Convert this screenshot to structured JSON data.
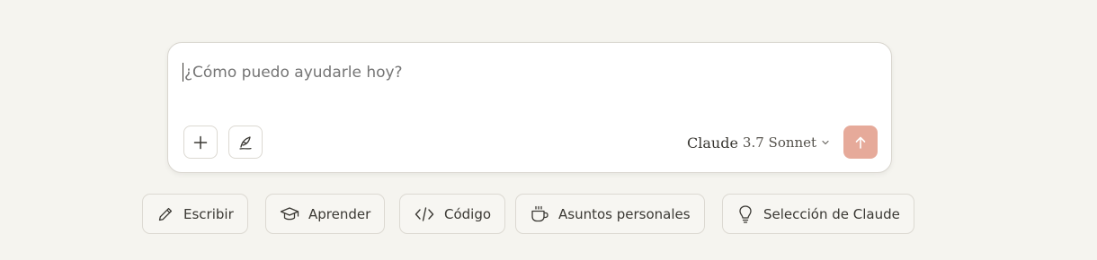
{
  "composer": {
    "placeholder": "¿Cómo puedo ayudarle hoy?",
    "value": ""
  },
  "toolbar": {
    "add_icon": "plus-icon",
    "style_icon": "quill-icon"
  },
  "model": {
    "name": "Claude",
    "version": "3.7 Sonnet"
  },
  "send": {
    "icon": "arrow-up-icon",
    "color": "#e6aa9a"
  },
  "suggestions": [
    {
      "label": "Escribir",
      "icon": "pencil-icon"
    },
    {
      "label": "Aprender",
      "icon": "graduation-cap-icon"
    },
    {
      "label": "Código",
      "icon": "code-icon"
    },
    {
      "label": "Asuntos personales",
      "icon": "coffee-cup-icon"
    },
    {
      "label": "Selección de Claude",
      "icon": "lightbulb-icon"
    }
  ]
}
